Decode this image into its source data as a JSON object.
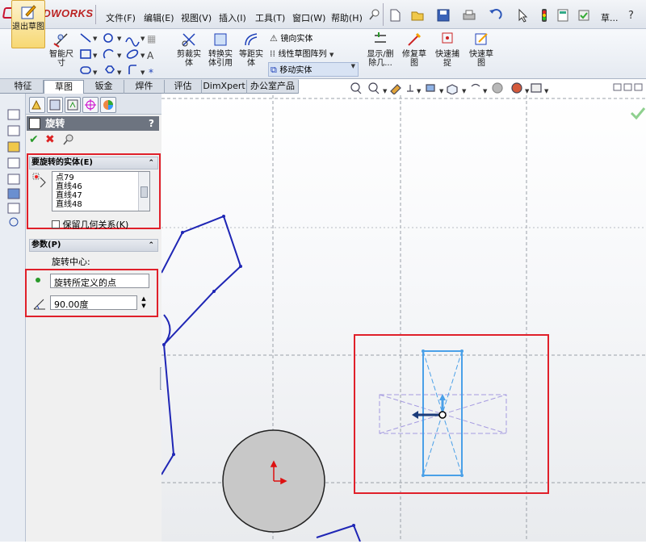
{
  "app": {
    "logo_text": "SOLIDWORKS"
  },
  "menu": [
    "文件(F)",
    "编辑(E)",
    "视图(V)",
    "插入(I)",
    "工具(T)",
    "窗口(W)",
    "帮助(H)"
  ],
  "title_partial": "草...",
  "help_glyph": "?",
  "ribbon": {
    "exit_sketch": "退出草图",
    "smart_dim": "智能尺寸",
    "trim": "剪裁实体",
    "convert": "转换实体引用",
    "offset": "等距实体",
    "mirror": "镜向实体",
    "linear_pattern": "线性草图阵列",
    "move": "移动实体",
    "show_delete": "显示/删除几...",
    "repair": "修复草图",
    "quick_snap": "快速捕捉",
    "rapid_sketch": "快速草图"
  },
  "tabs": [
    "特征",
    "草图",
    "钣金",
    "焊件",
    "评估",
    "DimXpert",
    "办公室产品"
  ],
  "active_tab": "草图",
  "property_manager": {
    "title": "旋转",
    "help": "?",
    "entities_section": {
      "title": "要旋转的实体(E)",
      "items": [
        "点79",
        "直线46",
        "直线47",
        "直线48"
      ],
      "keep_relations": "保留几何关系(K)"
    },
    "params_section": {
      "title": "参数(P)",
      "center_label": "旋转中心:",
      "center_value": "旋转所定义的点",
      "angle_value": "90.00度"
    }
  },
  "colors": {
    "sketch_line": "#1f26b5",
    "selected": "#4aa0e8",
    "highlight_box": "#e0202a",
    "circle_fill": "#c8c8c8"
  }
}
